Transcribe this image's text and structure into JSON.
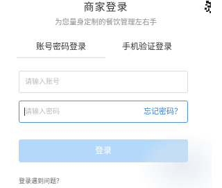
{
  "header": {
    "title": "商家登录",
    "subtitle": "为您量身定制的餐饮管理左右手"
  },
  "tabs": [
    {
      "label": "账号密码登录",
      "active": true
    },
    {
      "label": "手机验证登录",
      "active": false
    }
  ],
  "form": {
    "account_placeholder": "请输入账号",
    "password_placeholder": "请输入密码",
    "forgot_label": "忘记密码？",
    "login_label": "登录"
  },
  "footer": {
    "help_label": "登录遇到问题？"
  },
  "colors": {
    "link": "#2f7fe0",
    "focus_border": "#4f90ea",
    "button_disabled": "#b3d8f9"
  },
  "icons": {
    "corner": "qr-code-icon"
  }
}
